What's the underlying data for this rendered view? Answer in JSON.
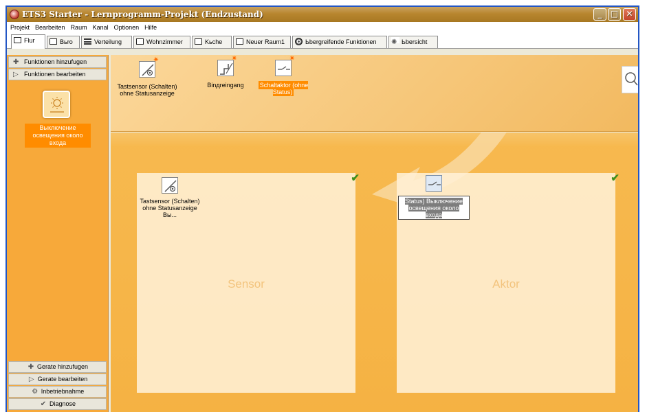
{
  "window": {
    "title": "ETS3 Starter - Lernprogramm-Projekt (Endzustand)"
  },
  "title_buttons": {
    "minimize": "_",
    "maximize": "□",
    "close": "✕"
  },
  "menu": [
    "Projekt",
    "Bearbeiten",
    "Raum",
    "Kanal",
    "Optionen",
    "Hilfe"
  ],
  "tabs": [
    {
      "label": "Flur",
      "icon": "room-icon",
      "active": true
    },
    {
      "label": "Bьro",
      "icon": "room-icon"
    },
    {
      "label": "Verteilung",
      "icon": "list-icon"
    },
    {
      "label": "Wohnzimmer",
      "icon": "room-icon"
    },
    {
      "label": "Kьche",
      "icon": "room-icon"
    },
    {
      "label": "Neuer Raum1",
      "icon": "room-icon"
    },
    {
      "label": "Ьbergreifende Funktionen",
      "icon": "target-icon"
    },
    {
      "label": "Ьbersicht",
      "icon": "eye-icon"
    }
  ],
  "left_panel": {
    "add_functions": "Funktionen hinzufugen",
    "edit_functions": "Funktionen bearbeiten",
    "function_label": "Выключение освещения около входа",
    "add_devices": "Gerate hinzufugen",
    "edit_devices": "Gerate bearbeiten",
    "commissioning": "Inbetriebnahme",
    "diagnose": "Diagnose"
  },
  "device_strip": {
    "items": [
      {
        "label": "Tastsensor (Schalten) ohne Statusanzeige",
        "icon": "push-button-sensor-icon"
      },
      {
        "label": "Binдreingang",
        "icon": "binary-input-icon"
      },
      {
        "label": "Schaltaktor (ohne Status)",
        "icon": "switch-actuator-icon",
        "selected": true
      }
    ]
  },
  "zones": {
    "sensor": {
      "title": "Sensor",
      "item_label": "Tastsensor (Schalten) ohne Statusanzeige Вы..."
    },
    "actor": {
      "title": "Aktor",
      "item_label": "Status) Выключение освещения около входа"
    }
  },
  "colors": {
    "accent": "#ff8c00",
    "panel": "#f7a93a",
    "check": "#3e8f1d"
  }
}
